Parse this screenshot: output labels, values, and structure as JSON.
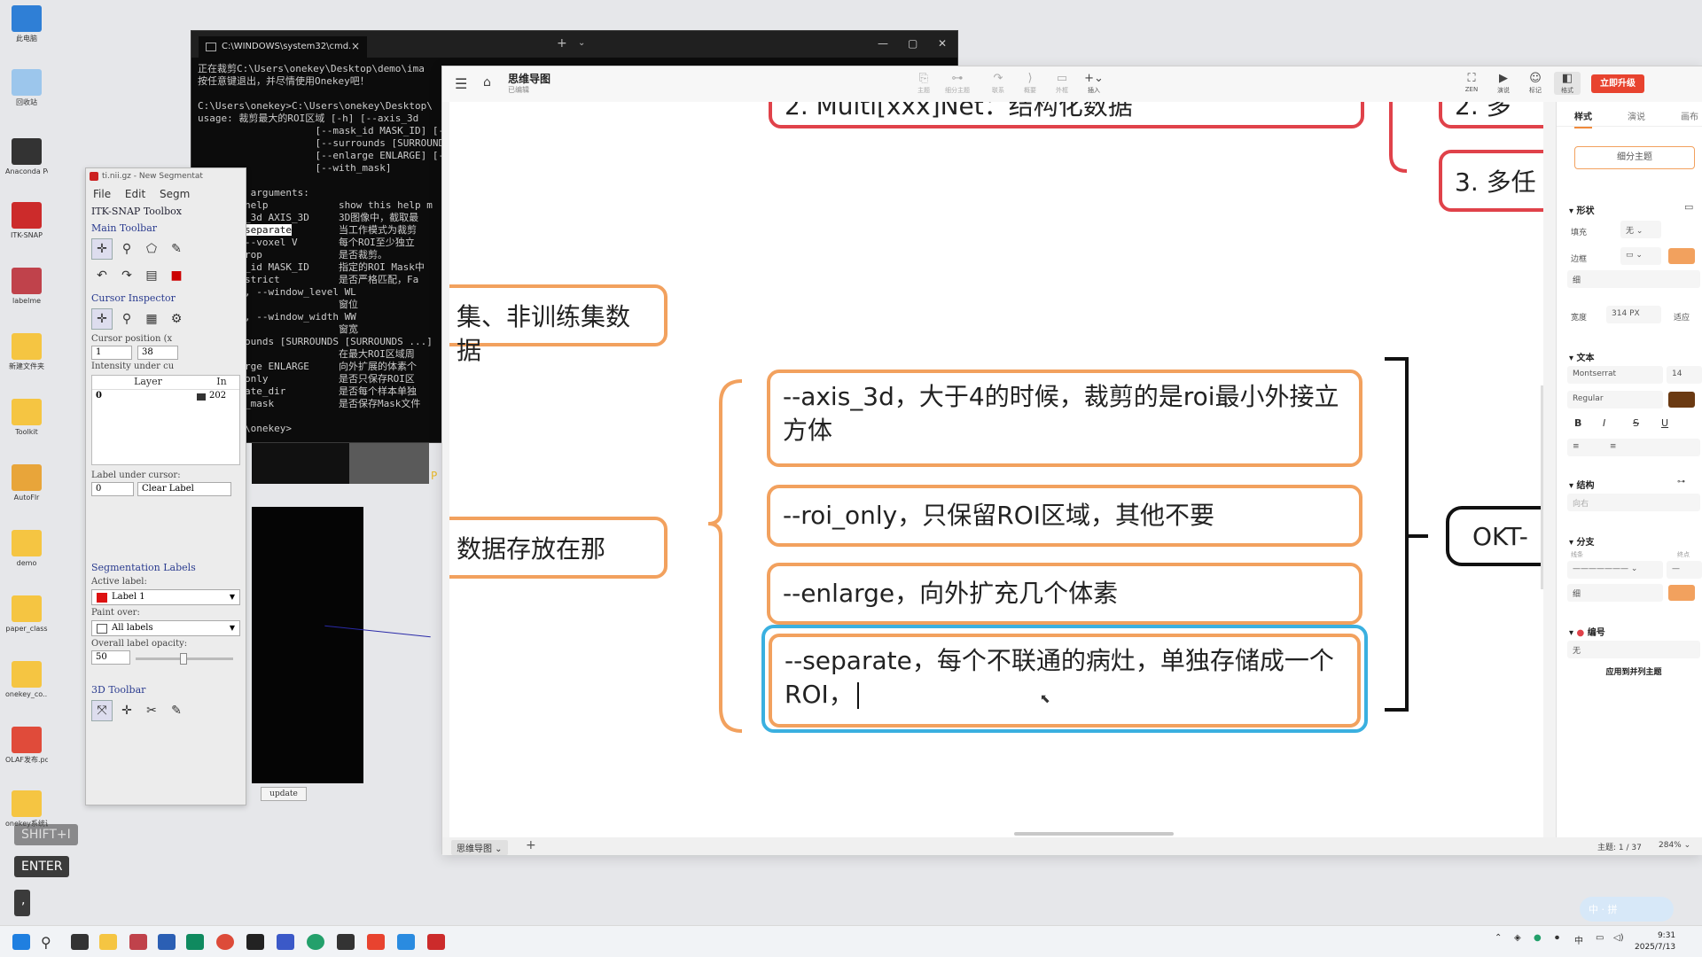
{
  "desktop": {
    "icons": [
      {
        "label": "此电脑",
        "color": "#2f7fd6"
      },
      {
        "label": "回收站",
        "color": "#9cc6ec"
      },
      {
        "label": "Anaconda Powersh...",
        "color": "#333333"
      },
      {
        "label": "ITK-SNAP",
        "color": "#cc2b2b"
      },
      {
        "label": "labelme",
        "color": "#c0424b"
      },
      {
        "label": "新建文件夹",
        "color": "#f5c542"
      },
      {
        "label": "Toolkit",
        "color": "#f5c542"
      },
      {
        "label": "AutoFlr",
        "color": "#e8a53a"
      },
      {
        "label": "demo",
        "color": "#f5c542"
      },
      {
        "label": "paper_class",
        "color": "#f5c542"
      },
      {
        "label": "onekey_co...",
        "color": "#f5c542"
      },
      {
        "label": "OLAF发布.pdf",
        "color": "#e04b3a"
      },
      {
        "label": "onekey系统课件-交流...",
        "color": "#f5c542"
      }
    ]
  },
  "cmd": {
    "tab_title": "C:\\WINDOWS\\system32\\cmd.",
    "lines": [
      "正在裁剪C:\\Users\\onekey\\Desktop\\demo\\ima",
      "按任意键退出，并尽情使用Onekey吧！",
      "",
      "C:\\Users\\onekey>C:\\Users\\onekey\\Desktop\\",
      "usage: 裁剪最大的ROI区域 [-h] [--axis_3d",
      "                    [--mask_id MASK_ID] [-",
      "                    [--surrounds [SURROUND",
      "                    [--enlarge ENLARGE] [-",
      "                    [--with_mask]",
      "",
      "optional arguments:",
      "  -h, --help            show this help m",
      "  --axis_3d AXIS_3D     3D图像中，截取最",
      "  -s, --separate        当工作模式为裁剪",
      "  -v V, --voxel V       每个ROI至少独立",
      "  --no_crop             是否裁剪。",
      "  --mask_id MASK_ID     指定的ROI Mask中",
      "  --not_strict          是否严格匹配，Fa",
      "  -wl WL, --window_level WL",
      "                        窗位",
      "  -ww WW, --window_width WW",
      "                        窗宽",
      "  --surrounds [SURROUNDS [SURROUNDS ...]",
      "                        在最大ROI区域周",
      "  --enlarge ENLARGE     向外扩展的体素个",
      "  --roi_only            是否只保存ROI区",
      "  --isolate_dir         是否每个样本单独",
      "  --with_mask           是否保存Mask文件",
      "",
      "C:\\Users\\onekey>"
    ],
    "highlight": "--separate"
  },
  "itk": {
    "window_title": "ti.nii.gz - New Segmentat",
    "menu": [
      "File",
      "Edit",
      "Segm"
    ],
    "toolbox_title": "ITK-SNAP Toolbox",
    "main_toolbar": "Main Toolbar",
    "cursor_inspector": "Cursor Inspector",
    "cursor_position_label": "Cursor position (x",
    "cursor_x": "1",
    "cursor_y": "38",
    "intensity_label": "Intensity under cu",
    "layer_header": "Layer",
    "intensity_header": "In",
    "layer_row": "0",
    "intensity_row": "202",
    "label_under_cursor": "Label under cursor:",
    "label_id": "0",
    "label_name": "Clear Label",
    "seg_labels_title": "Segmentation Labels",
    "active_label_caption": "Active label:",
    "active_label": "Label 1",
    "paint_over_caption": "Paint over:",
    "paint_over": "All labels",
    "opacity_caption": "Overall label opacity:",
    "opacity_value": "50",
    "toolbar_3d": "3D Toolbar",
    "update_button": "update",
    "overlay_letter": "P"
  },
  "mindmap": {
    "app_title": "思维导图",
    "saved_status": "已编辑",
    "toolbar": [
      {
        "icon": "subtopic-icon",
        "label": "主题"
      },
      {
        "icon": "child-topic-icon",
        "label": "细分主题"
      },
      {
        "icon": "relation-icon",
        "label": "联系"
      },
      {
        "icon": "summary-icon",
        "label": "概要"
      },
      {
        "icon": "boundary-icon",
        "label": "外框"
      },
      {
        "icon": "insert-icon",
        "label": "插入"
      }
    ],
    "right_tools": [
      {
        "icon": "zen-icon",
        "label": "ZEN"
      },
      {
        "icon": "present-icon",
        "label": "演说"
      },
      {
        "icon": "emoji-icon",
        "label": "标记"
      },
      {
        "icon": "format-icon",
        "label": "格式"
      }
    ],
    "upgrade": "立即升级",
    "nodes": {
      "top_center": "2. Multi[xxx]Net：结构化数据",
      "top_right_1": "2. 多",
      "top_right_2": "3. 多任",
      "left_1": "集、非训练集数据",
      "left_2": "数据存放在那",
      "opt_axis": "--axis_3d，大于4的时候，裁剪的是roi最小外接立方体",
      "opt_roi": "--roi_only，只保留ROI区域，其他不要",
      "opt_enlarge": "--enlarge，向外扩充几个体素",
      "opt_separate": "--separate，每个不联通的病灶，单独存储成一个ROI，",
      "okt": "OKT-"
    },
    "bottom": {
      "sheet": "思维导图",
      "topic_count": "主题: 1 / 37",
      "zoom": "284%"
    }
  },
  "panel": {
    "tabs": [
      "样式",
      "演说",
      "画布"
    ],
    "subtopic_button": "细分主题",
    "shape_section": "形状",
    "fill_label": "填充",
    "fill_value": "无",
    "border_label": "边框",
    "border_weight": "细",
    "width_label": "宽度",
    "width_value": "314",
    "width_unit": "PX",
    "width_auto": "适应",
    "text_section": "文本",
    "font": "Montserrat",
    "font_size": "14",
    "font_weight": "Regular",
    "structure_section": "结构",
    "structure_value": "向右",
    "branch_section": "分支",
    "line_label": "线条",
    "end_label": "终点",
    "branch_weight": "细",
    "numbering_section": "编号",
    "numbering_value": "无",
    "apply_button": "应用到并列主题",
    "accent": "#f2a15e",
    "text_color": "#6b3a12"
  },
  "keys": {
    "shift": "SHIFT+I",
    "enter": "ENTER",
    "comma": ","
  },
  "ime": "中 · 拼",
  "taskbar": {
    "time": "9:31",
    "date": "2025/7/13"
  }
}
